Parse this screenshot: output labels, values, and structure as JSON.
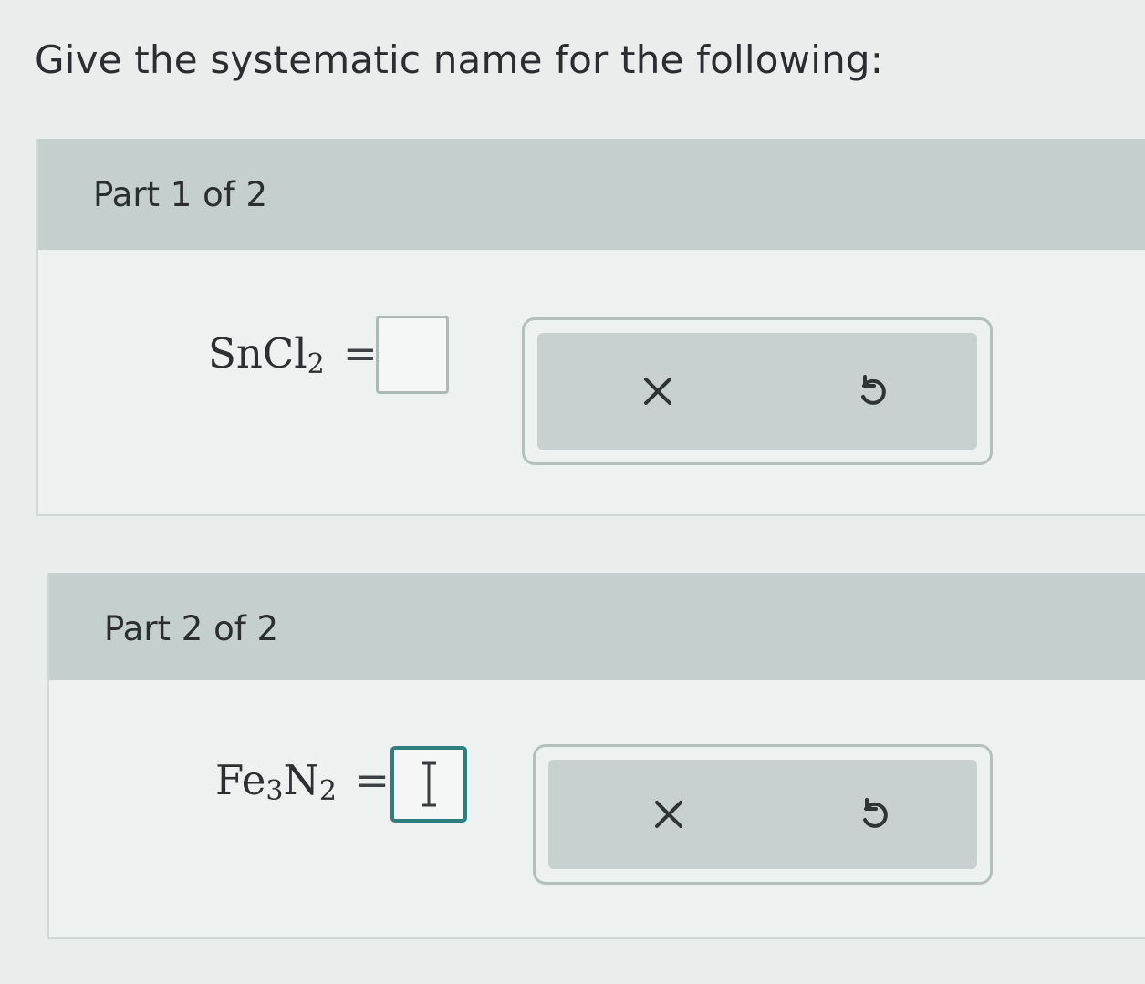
{
  "instruction": "Give the systematic name for the following:",
  "parts": [
    {
      "label": "Part 1 of 2",
      "formula": {
        "elements": [
          {
            "symbol": "SnCl",
            "subscript": "2"
          }
        ],
        "equals": "="
      },
      "answer_value": "",
      "answer_focused": false,
      "buttons": {
        "clear_icon": "x-icon",
        "undo_icon": "undo-icon"
      }
    },
    {
      "label": "Part 2 of 2",
      "formula": {
        "elements": [
          {
            "symbol": "Fe",
            "subscript": "3"
          },
          {
            "symbol": "N",
            "subscript": "2"
          }
        ],
        "equals": "="
      },
      "answer_value": "",
      "answer_focused": true,
      "buttons": {
        "clear_icon": "x-icon",
        "undo_icon": "undo-icon"
      }
    }
  ],
  "colors": {
    "accent": "#2d7f7f",
    "header_bg": "#c5cfcd",
    "panel_bg": "#edf1ef",
    "button_bg": "#c8d1cf"
  }
}
